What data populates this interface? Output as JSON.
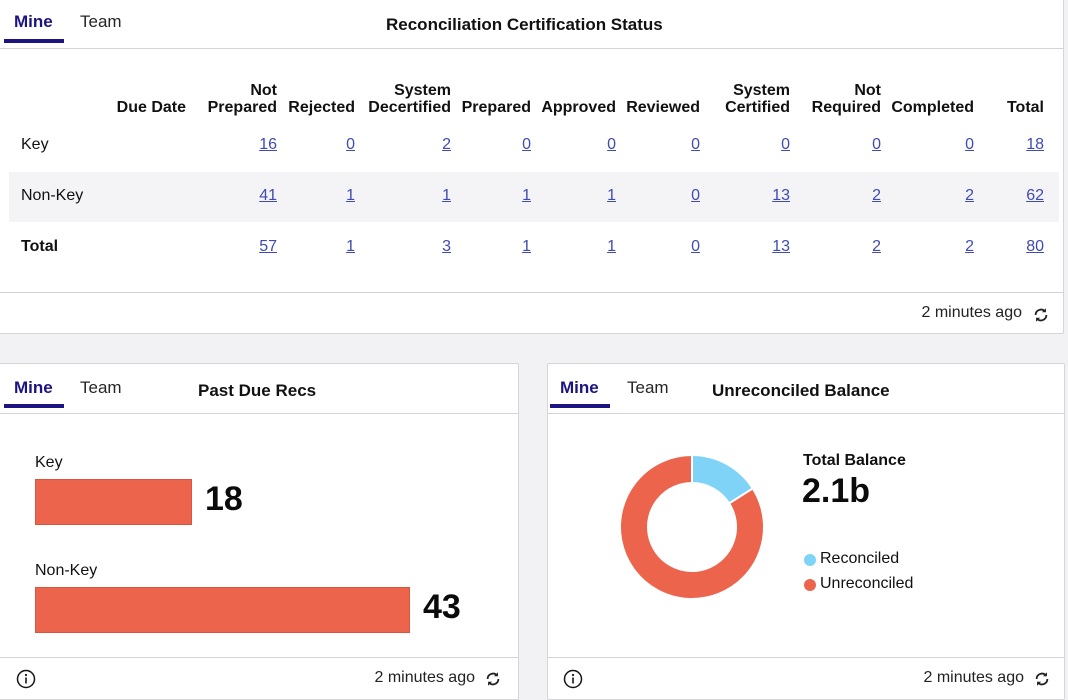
{
  "certification_panel": {
    "tabs": [
      {
        "label": "Mine",
        "active": true
      },
      {
        "label": "Team",
        "active": false
      }
    ],
    "title": "Reconciliation Certification Status",
    "columns": [
      {
        "line1": "",
        "line2": "Due Date"
      },
      {
        "line1": "Not",
        "line2": "Prepared"
      },
      {
        "line1": "",
        "line2": "Rejected"
      },
      {
        "line1": "System",
        "line2": "Decertified"
      },
      {
        "line1": "",
        "line2": "Prepared"
      },
      {
        "line1": "",
        "line2": "Approved"
      },
      {
        "line1": "",
        "line2": "Reviewed"
      },
      {
        "line1": "System",
        "line2": "Certified"
      },
      {
        "line1": "Not",
        "line2": "Required"
      },
      {
        "line1": "",
        "line2": "Completed"
      },
      {
        "line1": "",
        "line2": "Total"
      }
    ],
    "rows": [
      {
        "label": "Key",
        "values": [
          "16",
          "0",
          "2",
          "0",
          "0",
          "0",
          "0",
          "0",
          "0",
          "18"
        ]
      },
      {
        "label": "Non-Key",
        "values": [
          "41",
          "1",
          "1",
          "1",
          "1",
          "0",
          "13",
          "2",
          "2",
          "62"
        ]
      },
      {
        "label": "Total",
        "values": [
          "57",
          "1",
          "3",
          "1",
          "1",
          "0",
          "13",
          "2",
          "2",
          "80"
        ]
      }
    ],
    "updated": "2 minutes ago"
  },
  "past_due_panel": {
    "tabs": [
      {
        "label": "Mine",
        "active": true
      },
      {
        "label": "Team",
        "active": false
      }
    ],
    "title": "Past Due Recs",
    "updated": "2 minutes ago"
  },
  "balance_panel": {
    "tabs": [
      {
        "label": "Mine",
        "active": true
      },
      {
        "label": "Team",
        "active": false
      }
    ],
    "title": "Unreconciled Balance",
    "total_label": "Total Balance",
    "total_value": "2.1b",
    "updated": "2 minutes ago"
  },
  "colors": {
    "accent": "#1c1480",
    "link": "#3f4bb0",
    "unreconciled": "#ec644c",
    "reconciled": "#7fd3f7"
  },
  "chart_data": [
    {
      "type": "bar",
      "title": "Past Due Recs",
      "orientation": "horizontal",
      "categories": [
        "Key",
        "Non-Key"
      ],
      "values": [
        18,
        43
      ],
      "xlabel": "",
      "ylabel": "",
      "xlim": [
        0,
        43
      ]
    },
    {
      "type": "pie",
      "title": "Unreconciled Balance",
      "donut": true,
      "labels": [
        "Reconciled",
        "Unreconciled"
      ],
      "values": [
        16,
        84
      ],
      "value_units": "percent (estimated)",
      "center_label": "Total Balance",
      "center_value": "2.1b",
      "legend": "right"
    }
  ]
}
